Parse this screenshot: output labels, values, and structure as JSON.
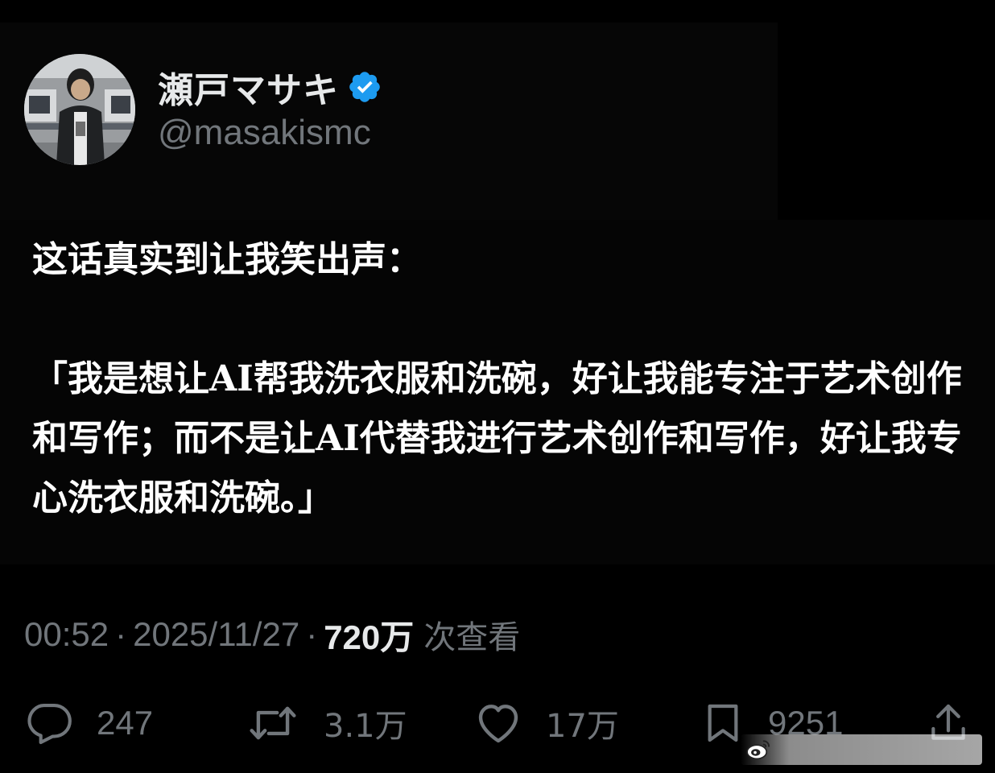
{
  "profile": {
    "display_name": "瀬戸マサキ",
    "handle": "@masakismc",
    "avatar_icon": "avatar-photo",
    "verified_icon": "verified-badge-icon",
    "verified_color": "#1d9bf0"
  },
  "tweet": {
    "text": "这话真实到让我笑出声：\n\n「我是想让AI帮我洗衣服和洗碗，好让我能专注于艺术创作和写作；而不是让AI代替我进行艺术创作和写作，好让我专心洗衣服和洗碗。」"
  },
  "meta": {
    "time": "00:52",
    "separator": "·",
    "date": "2025/11/27",
    "views_count": "720万",
    "views_label": "次查看"
  },
  "actions": {
    "reply": {
      "icon": "reply-icon",
      "count": "247"
    },
    "retweet": {
      "icon": "retweet-icon",
      "count": "3.1万"
    },
    "like": {
      "icon": "heart-icon",
      "count": "17万"
    },
    "bookmark": {
      "icon": "bookmark-icon",
      "count": "9251"
    },
    "share": {
      "icon": "share-icon"
    }
  },
  "colors": {
    "background": "#000000",
    "text_primary": "#e7e9ea",
    "text_secondary": "#71767b",
    "accent": "#1d9bf0"
  }
}
